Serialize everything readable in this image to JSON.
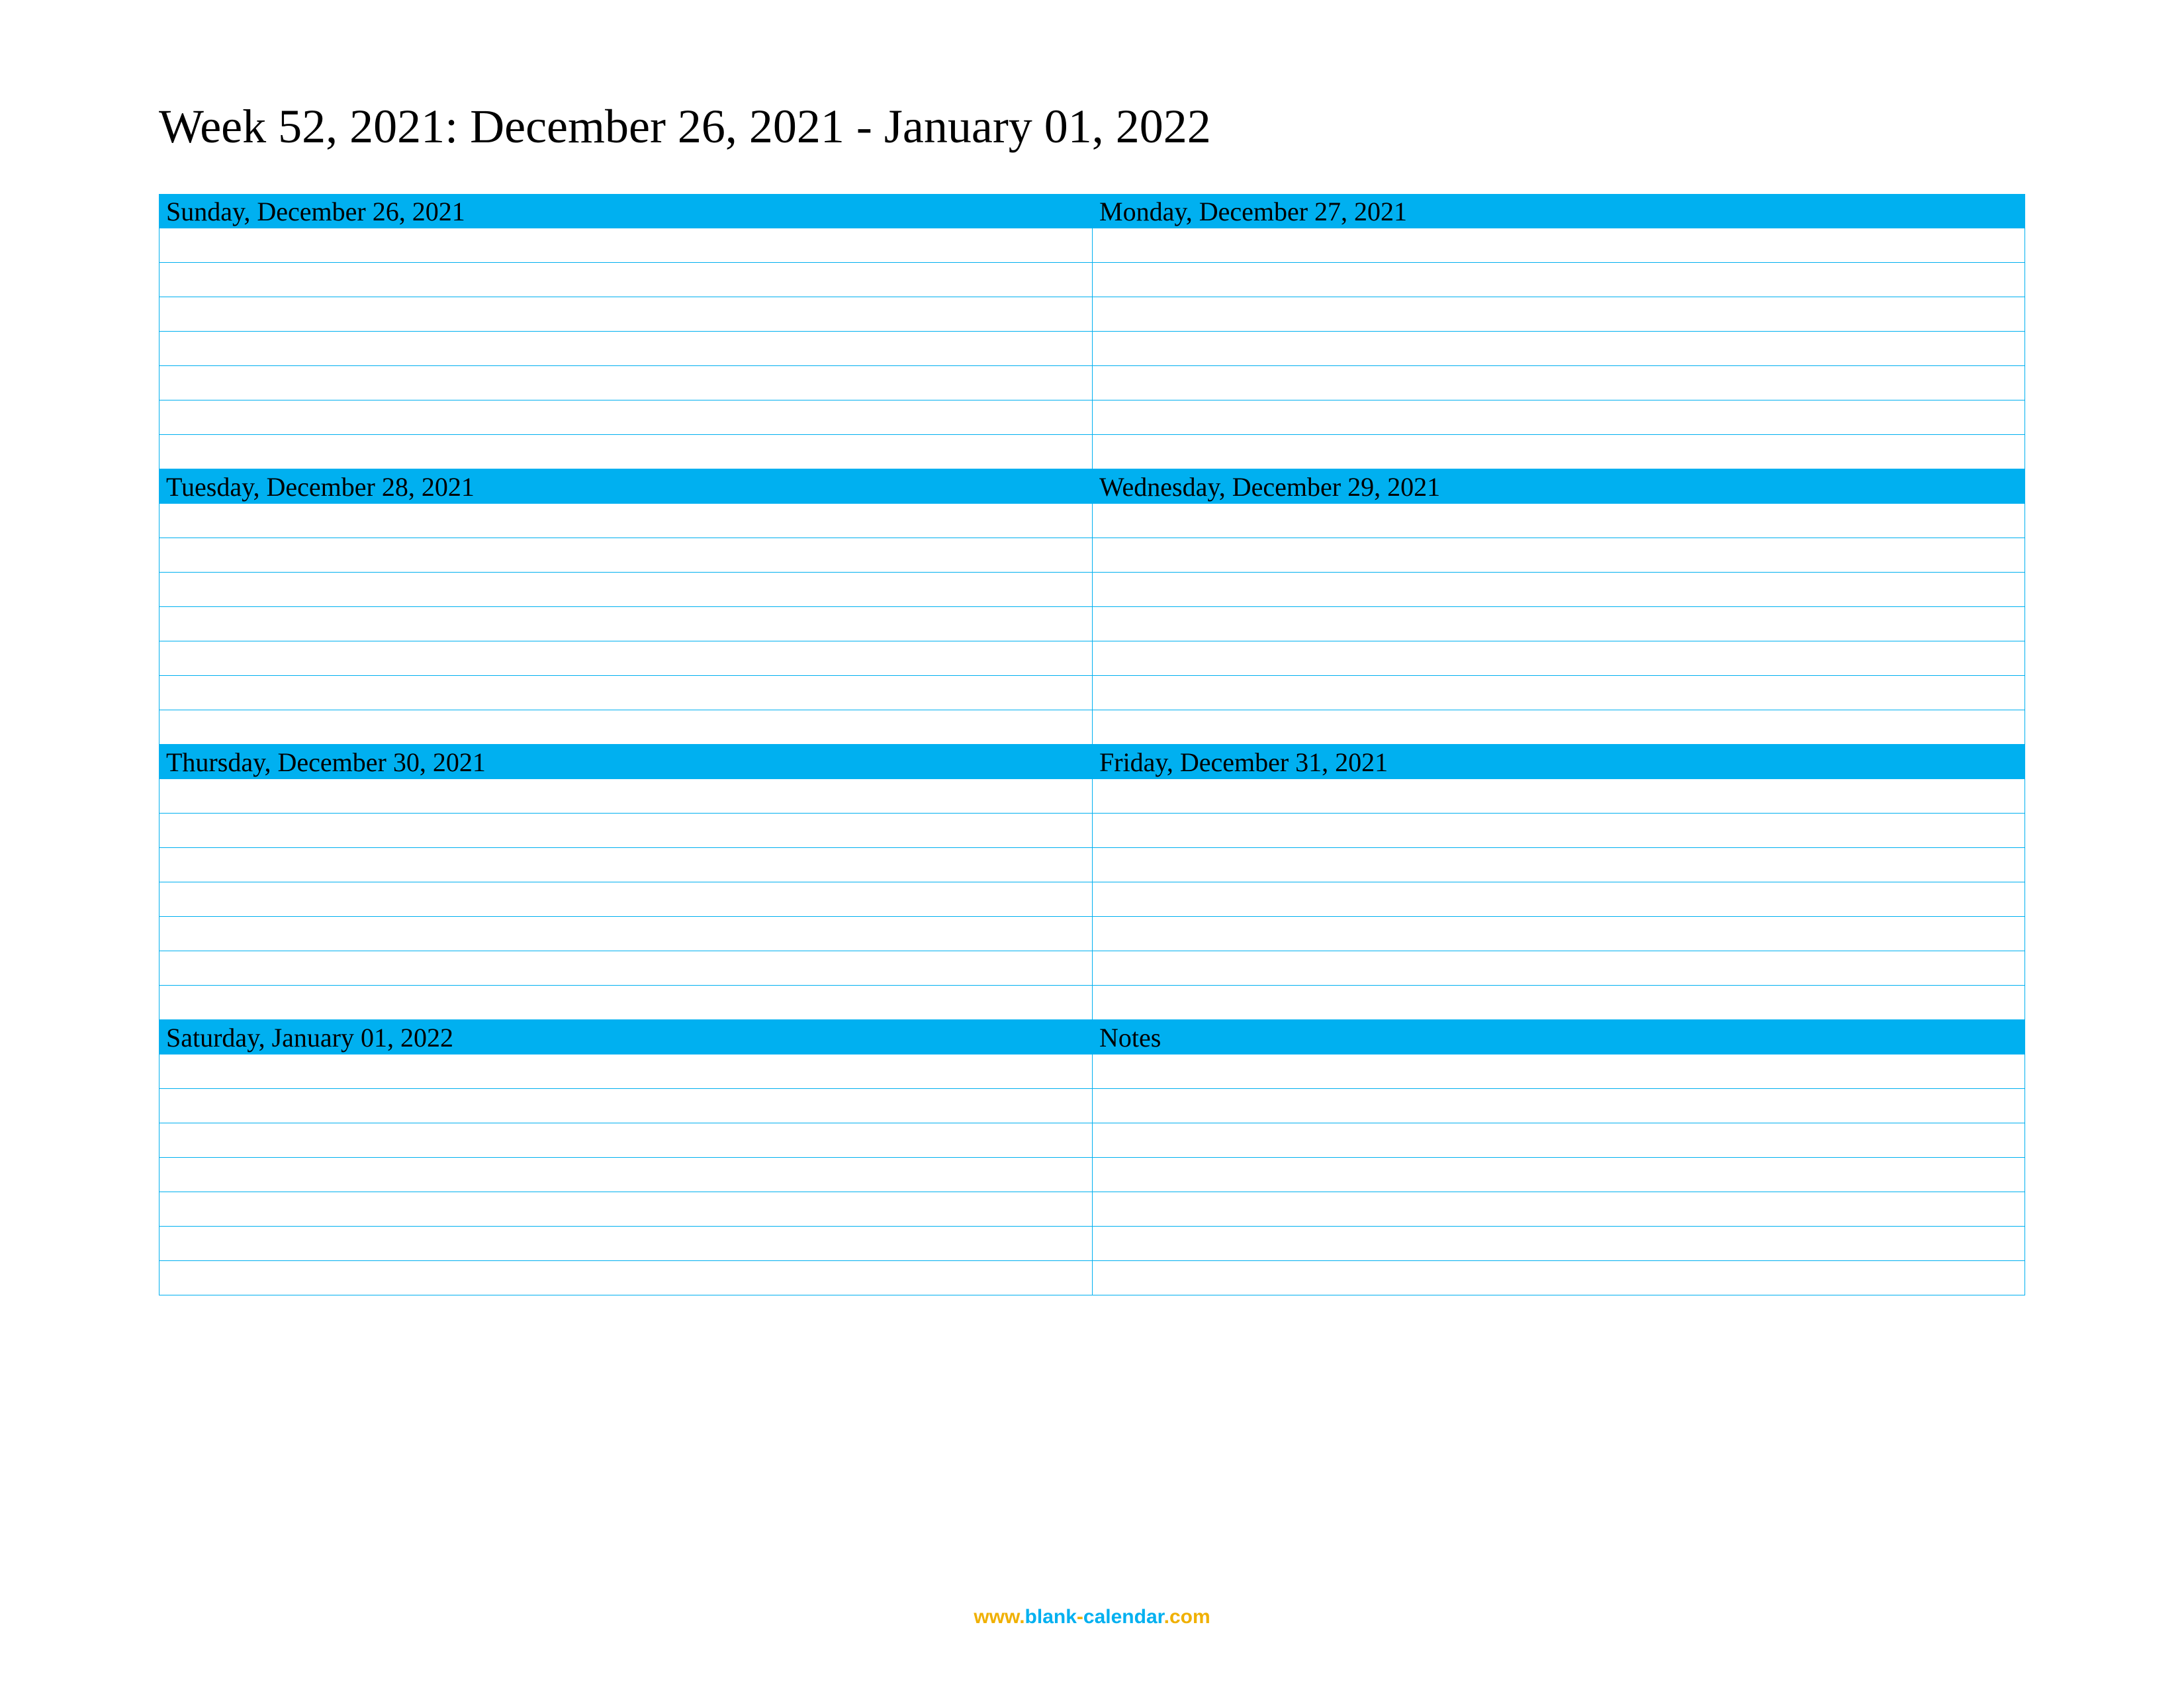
{
  "title": "Week 52, 2021: December 26, 2021 - January 01, 2022",
  "days": [
    {
      "label": "Sunday, December 26, 2021"
    },
    {
      "label": "Monday, December 27, 2021"
    },
    {
      "label": "Tuesday, December 28, 2021"
    },
    {
      "label": "Wednesday, December 29, 2021"
    },
    {
      "label": "Thursday, December 30, 2021"
    },
    {
      "label": "Friday, December 31, 2021"
    },
    {
      "label": "Saturday, January 01, 2022"
    },
    {
      "label": "Notes"
    }
  ],
  "rows_per_day": 7,
  "footer": {
    "www": "www.",
    "blank": "blank",
    "dash": "-",
    "calendar": "calendar",
    "com": ".com"
  }
}
